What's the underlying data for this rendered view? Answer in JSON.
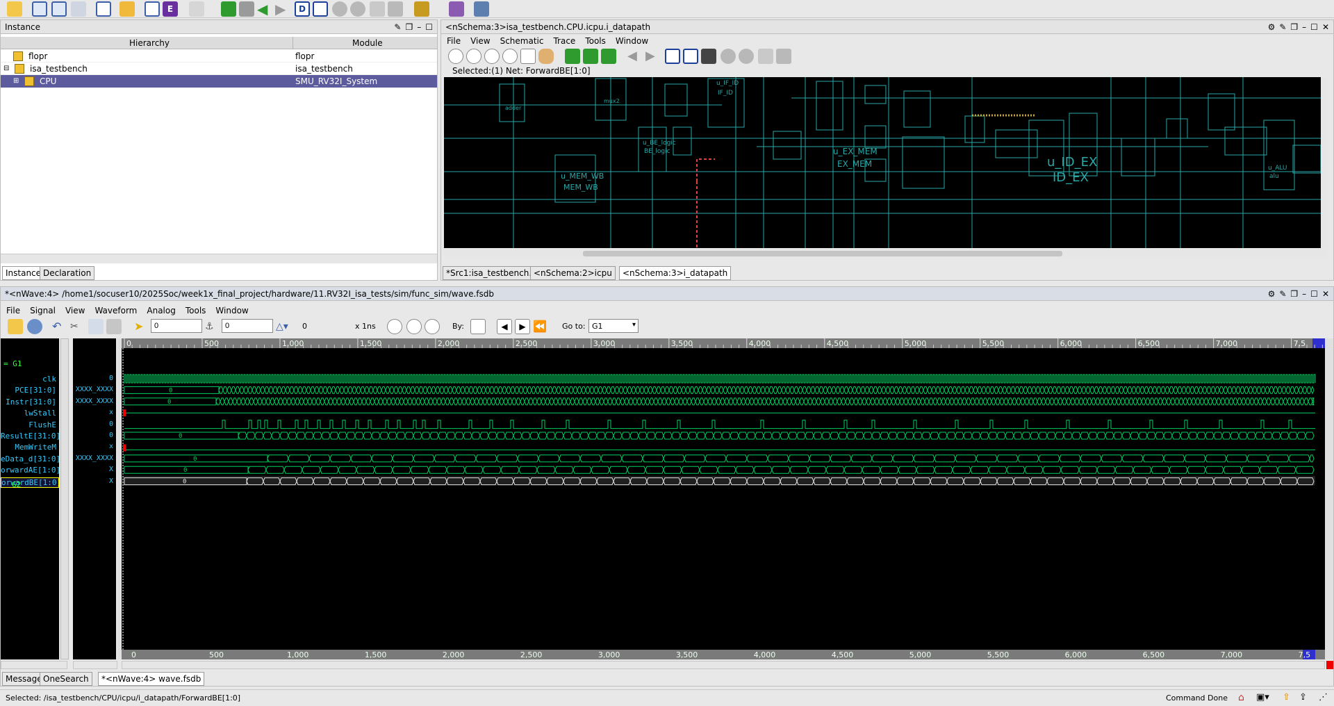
{
  "toolbar_main": {
    "icons": [
      "open-folder-icon",
      "memory-icon",
      "memory2-icon",
      "hierarchy-icon",
      "schematic-icon",
      "folder-icon",
      "edit-icon",
      "e-icon",
      "list-icon",
      "green-l-icon",
      "page-icon",
      "back-arrow-icon",
      "fwd-arrow-icon",
      "d-icon",
      "play-icon",
      "up-icon",
      "down-icon",
      "tree-icon",
      "tool-icon",
      "fsdb-icon",
      "key-icon"
    ]
  },
  "instance": {
    "title": "Instance",
    "col_hierarchy": "Hierarchy",
    "col_module": "Module",
    "rows": [
      {
        "name": "flopr",
        "module": "flopr",
        "selected": false
      },
      {
        "name": "isa_testbench",
        "module": "isa_testbench",
        "selected": false
      },
      {
        "name": "CPU",
        "module": "SMU_RV32I_System",
        "selected": true
      }
    ],
    "tabs": [
      "Instance",
      "Declaration"
    ]
  },
  "schema": {
    "title": "<nSchema:3>isa_testbench.CPU.icpu.i_datapath",
    "menu": [
      "File",
      "View",
      "Schematic",
      "Trace",
      "Tools",
      "Window"
    ],
    "status": "Selected:(1) Net: ForwardBE[1:0]",
    "blocks": [
      "u_ID_EX",
      "ID_EX",
      "u_EX_MEM",
      "EX_MEM",
      "u_MEM_WB",
      "MEM_WB",
      "u_IF_ID",
      "IF_ID",
      "u_BE_logic",
      "BE_logic",
      "u_ALU",
      "alu",
      "adder",
      "mux2"
    ],
    "tabs": [
      "*Src1:isa_testbench.v",
      "<nSchema:2>icpu",
      "<nSchema:3>i_datapath"
    ]
  },
  "wave": {
    "title": "*<nWave:4> /home1/socuser10/2025Soc/week1x_final_project/hardware/11.RV32I_isa_tests/sim/func_sim/wave.fsdb",
    "menu": [
      "File",
      "Signal",
      "View",
      "Waveform",
      "Analog",
      "Tools",
      "Window"
    ],
    "cursor1": "0",
    "cursor2": "0",
    "delta": "0",
    "timescale": "x 1ns",
    "by_label": "By:",
    "goto_label": "Go to:",
    "goto_value": "G1",
    "group1": "= G1",
    "group2": "G2",
    "signals": [
      {
        "name": "clk",
        "value": "0"
      },
      {
        "name": "PCE[31:0]",
        "value": "XXXX_XXXX"
      },
      {
        "name": "Instr[31:0]",
        "value": "XXXX_XXXX"
      },
      {
        "name": "lwStall",
        "value": "x"
      },
      {
        "name": "FlushE",
        "value": "0"
      },
      {
        "name": "ResultE[31:0]",
        "value": "0"
      },
      {
        "name": "MemWriteM",
        "value": "x"
      },
      {
        "name": "eData_d[31:0]",
        "value": "XXXX_XXXX"
      },
      {
        "name": "orwardAE[1:0]",
        "value": "X"
      },
      {
        "name": "orwardBE[1:0]",
        "value": "X"
      }
    ],
    "ticks": [
      "0",
      "500",
      "1,000",
      "1,500",
      "2,000",
      "2,500",
      "3,000",
      "3,500",
      "4,000",
      "4,500",
      "5,000",
      "5,500",
      "6,000",
      "6,500",
      "7,000",
      "7,5"
    ],
    "bottom_tabs": [
      "Message",
      "OneSearch",
      "*<nWave:4> wave.fsdb"
    ]
  },
  "statusbar": {
    "left": "Selected: /isa_testbench/CPU/icpu/i_datapath/ForwardBE[1:0]",
    "right": "Command Done"
  },
  "colors": {
    "wave_green": "#00d060",
    "wave_sel": "#e0e0e0",
    "selection": "#5b5b9e",
    "cyan": "#2aa7a7"
  }
}
